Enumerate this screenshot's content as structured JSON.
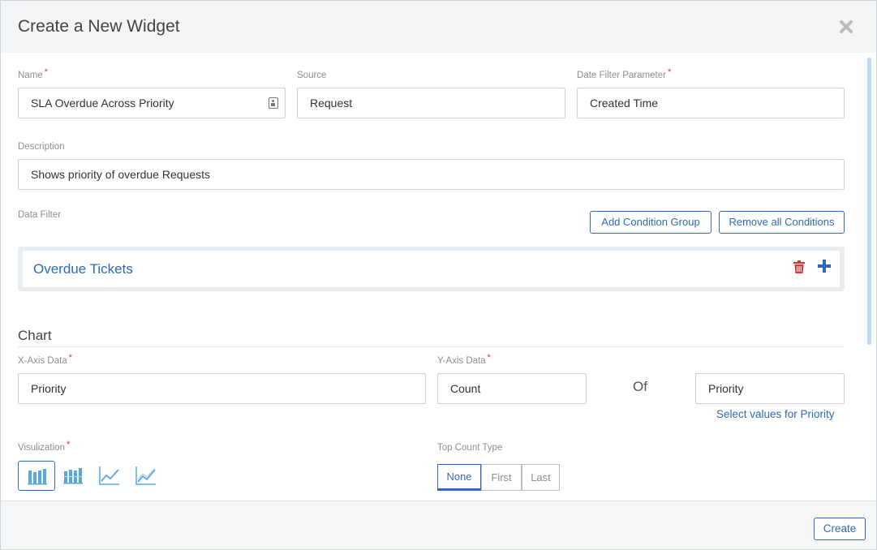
{
  "dialog": {
    "title": "Create a New Widget",
    "close_icon": "close-icon"
  },
  "form": {
    "name": {
      "label": "Name",
      "required": "*",
      "value": "SLA Overdue Across Priority"
    },
    "source": {
      "label": "Source",
      "value": "Request"
    },
    "date_filter": {
      "label": "Date Filter Parameter",
      "required": "*",
      "value": "Created Time"
    },
    "description": {
      "label": "Description",
      "value": "Shows priority of  overdue Requests"
    },
    "data_filter": {
      "label": "Data Filter",
      "add_group_label": "Add Condition Group",
      "remove_all_label": "Remove all Conditions",
      "condition_group": {
        "title": "Overdue Tickets"
      }
    }
  },
  "chart": {
    "section_title": "Chart",
    "x_axis": {
      "label": "X-Axis Data",
      "required": "*",
      "value": "Priority"
    },
    "y_axis": {
      "label": "Y-Axis Data",
      "required": "*",
      "value": "Count",
      "of_label": "Of",
      "of_value": "Priority"
    },
    "select_values_link": "Select values for Priority",
    "visualization": {
      "label": "Visulization",
      "required": "*",
      "options": [
        "bar-chart-icon",
        "stacked-bar-chart-icon",
        "line-chart-icon",
        "area-line-chart-icon"
      ],
      "selected_index": 0
    },
    "top_count": {
      "label": "Top Count Type",
      "options": [
        "None",
        "First",
        "Last"
      ],
      "selected": "None"
    }
  },
  "footer": {
    "create_label": "Create"
  },
  "colors": {
    "accent": "#2e6bb8",
    "required": "#e0322f",
    "delete": "#e0322f"
  }
}
